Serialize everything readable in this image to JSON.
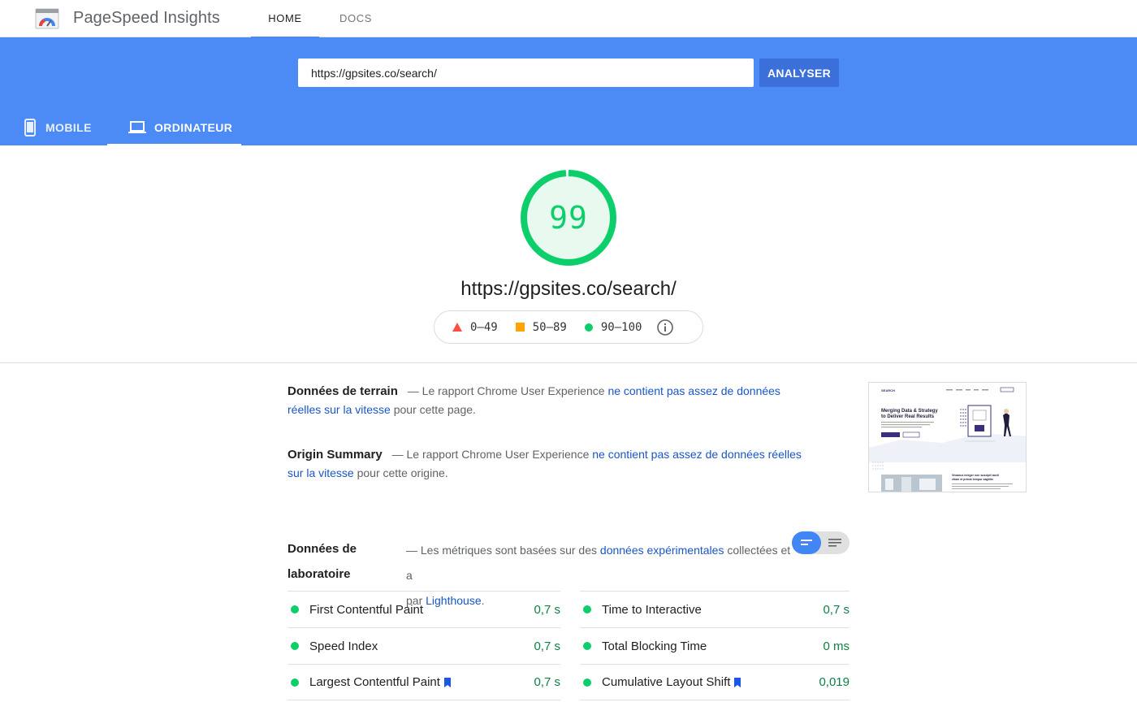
{
  "header": {
    "app_title": "PageSpeed Insights",
    "nav": [
      {
        "label": "HOME",
        "active": true
      },
      {
        "label": "DOCS",
        "active": false
      }
    ]
  },
  "search": {
    "url_value": "https://gpsites.co/search/",
    "analyze_label": "ANALYSER"
  },
  "device_tabs": [
    {
      "label": "MOBILE",
      "icon": "phone-icon",
      "active": false
    },
    {
      "label": "ORDINATEUR",
      "icon": "laptop-icon",
      "active": true
    }
  ],
  "score": {
    "value": "99",
    "fraction": 0.99,
    "url": "https://gpsites.co/search/",
    "color": "#0cce6b"
  },
  "legend": [
    {
      "range": "0–49",
      "shape": "triangle",
      "color": "#ff4e42"
    },
    {
      "range": "50–89",
      "shape": "square",
      "color": "#ffa400"
    },
    {
      "range": "90–100",
      "shape": "circle",
      "color": "#0cce6b"
    }
  ],
  "field_data": {
    "heading": "Données de terrain",
    "before": "— Le rapport Chrome User Experience ",
    "link": "ne contient pas assez de données réelles sur la vitesse",
    "after": " pour cette page."
  },
  "origin_summary": {
    "heading": "Origin Summary",
    "before": "— Le rapport Chrome User Experience ",
    "link": "ne contient pas assez de données réelles sur la vitesse",
    "after": " pour cette origine."
  },
  "lab_data": {
    "heading": "Données de laboratoire",
    "before": "— Les métriques sont basées sur des ",
    "link": "données expérimentales",
    "middle": " collectées et a",
    "line2_before": "par ",
    "line2_link": "Lighthouse",
    "line2_after": "."
  },
  "metrics_left": [
    {
      "name": "First Contentful Paint",
      "value": "0,7 s",
      "bookmark": false
    },
    {
      "name": "Speed Index",
      "value": "0,7 s",
      "bookmark": false
    },
    {
      "name": "Largest Contentful Paint",
      "value": "0,7 s",
      "bookmark": true
    }
  ],
  "metrics_right": [
    {
      "name": "Time to Interactive",
      "value": "0,7 s",
      "bookmark": false
    },
    {
      "name": "Total Blocking Time",
      "value": "0 ms",
      "bookmark": false
    },
    {
      "name": "Cumulative Layout Shift",
      "value": "0,019",
      "bookmark": true
    }
  ],
  "thumbnail": {
    "brand": "SEARCH",
    "headline_1": "Merging Data & Strategy",
    "headline_2": "to Deliver Real Results",
    "side_text_1": "Vivamus integer non suscipit taciti",
    "side_text_2": "etiam et primis tempor sagittis"
  }
}
